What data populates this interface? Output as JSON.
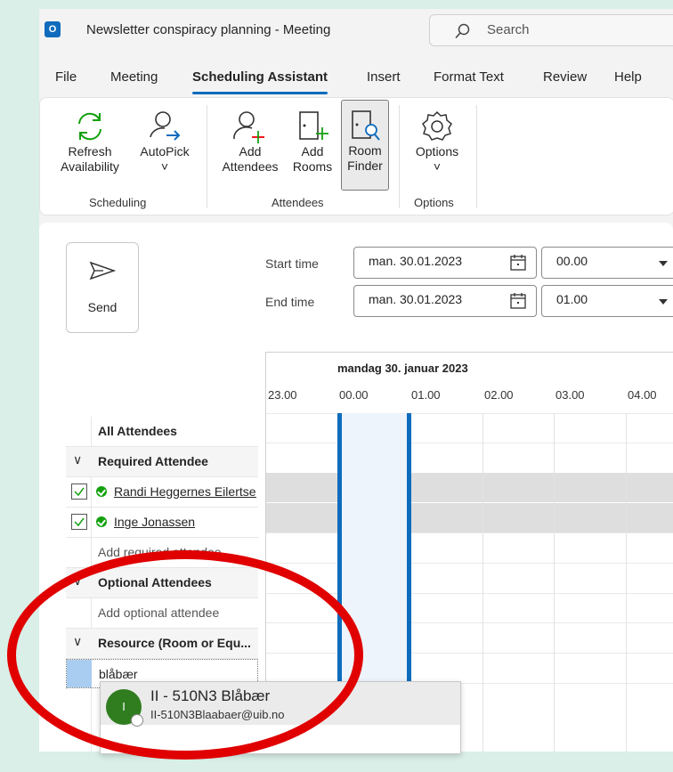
{
  "titlebar": {
    "app_logo": "O",
    "title": "Newsletter conspiracy planning  -  Meeting",
    "search_placeholder": "Search"
  },
  "menus": [
    "File",
    "Meeting",
    "Scheduling Assistant",
    "Insert",
    "Format Text",
    "Review",
    "Help"
  ],
  "active_menu": "Scheduling Assistant",
  "ribbon": {
    "refresh": [
      "Refresh",
      "Availability"
    ],
    "autopick": [
      "AutoPick",
      "˅"
    ],
    "add_attendees": [
      "Add",
      "Attendees"
    ],
    "add_rooms": [
      "Add",
      "Rooms"
    ],
    "room_finder": [
      "Room",
      "Finder"
    ],
    "options": [
      "Options",
      "˅"
    ],
    "groups": {
      "scheduling": "Scheduling",
      "attendees": "Attendees",
      "options": "Options"
    }
  },
  "send_label": "Send",
  "start": {
    "label": "Start time",
    "date": "man. 30.01.2023",
    "time": "00.00"
  },
  "end": {
    "label": "End time",
    "date": "man. 30.01.2023",
    "time": "01.00"
  },
  "day_header": "mandag 30. januar 2023",
  "hours": [
    "23.00",
    "00.00",
    "01.00",
    "02.00",
    "03.00",
    "04.00"
  ],
  "attendees": {
    "all": "All Attendees",
    "required_group": "Required Attendee",
    "required": [
      "Randi Heggernes Eilertsen",
      "Inge Jonassen"
    ],
    "add_required": "Add required attendee",
    "optional_group": "Optional Attendees",
    "add_optional": "Add optional attendee",
    "resource_group": "Resource (Room or Equ...",
    "resource_input": "blåbær"
  },
  "suggestion": {
    "initial": "I",
    "name": "II - 510N3 Blåbær",
    "email": "II-510N3Blaabaer@uib.no"
  },
  "colors": {
    "accent": "#0f6cbd",
    "annotation": "#e00000",
    "available": "#13a10e"
  }
}
